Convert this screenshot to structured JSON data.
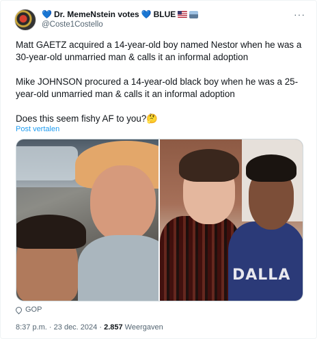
{
  "post": {
    "author": {
      "heart_left": "💙",
      "name": "Dr. MemeNstein votes",
      "heart_right": "💙",
      "tag": "BLUE",
      "handle": "@Coste1Costello"
    },
    "more_icon": "···",
    "paragraphs": [
      "Matt GAETZ acquired a 14-year-old boy named Nestor when he was a 30-year-old unmarried man & calls it an informal adoption",
      "Mike JOHNSON procured a 14-year-old black boy when he was a 25-year-old unmarried man & calls it an informal adoption",
      "Does this seem fishy AF to you?🤔"
    ],
    "translate_label": "Post vertalen",
    "images": {
      "right_jersey_text": "DALLA"
    },
    "location": "GOP",
    "time": "8:37 p.m.",
    "separator": "·",
    "date": "23 dec. 2024",
    "views_count": "2.857",
    "views_label": "Weergaven"
  }
}
